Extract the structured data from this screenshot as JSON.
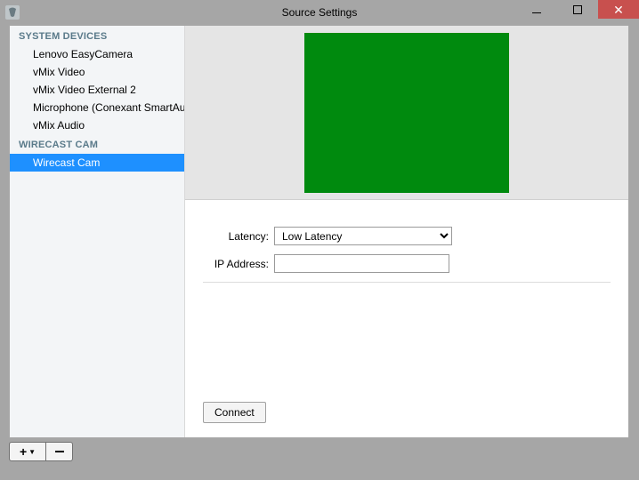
{
  "window": {
    "title": "Source Settings"
  },
  "sidebar": {
    "sections": [
      {
        "header": "SYSTEM DEVICES",
        "items": [
          {
            "label": "Lenovo EasyCamera",
            "selected": false
          },
          {
            "label": "vMix Video",
            "selected": false
          },
          {
            "label": "vMix Video External 2",
            "selected": false
          },
          {
            "label": "Microphone (Conexant SmartAudio",
            "selected": false
          },
          {
            "label": "vMix Audio",
            "selected": false
          }
        ]
      },
      {
        "header": "WIRECAST CAM",
        "items": [
          {
            "label": "Wirecast Cam",
            "selected": true
          }
        ]
      }
    ]
  },
  "preview": {
    "fill_color": "#008a0e"
  },
  "form": {
    "latency_label": "Latency:",
    "latency_value": "Low Latency",
    "ip_label": "IP Address:",
    "ip_value": ""
  },
  "buttons": {
    "connect": "Connect"
  },
  "icons": {
    "add": "+",
    "add_caret": "▼",
    "remove": "−"
  }
}
